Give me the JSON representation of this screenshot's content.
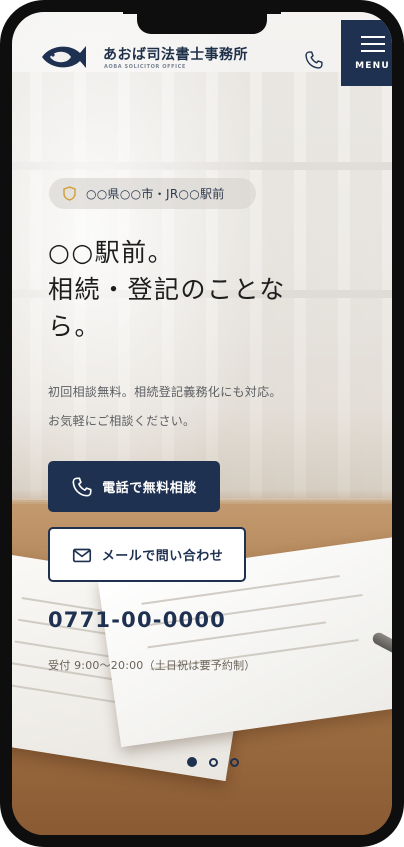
{
  "header": {
    "brand_name": "あおば司法書士事務所",
    "brand_subtitle": "AOBA SOLICITOR OFFICE",
    "menu_label": "MENU"
  },
  "hero": {
    "location_badge": "○○県○○市・JR○○駅前",
    "headline_line1": "○○駅前。",
    "headline_line2": "相続・登記のことな",
    "headline_line3": "ら。",
    "sub_line1": "初回相談無料。相続登記義務化にも対応。",
    "sub_line2": "お気軽にご相談ください。",
    "primary_button": "電話で無料相談",
    "secondary_button": "メールで問い合わせ",
    "phone_number": "0771-00-0000",
    "hours": "受付 9:00〜20:00（土日祝は要予約制）"
  },
  "slider": {
    "total": 3,
    "active_index": 0
  },
  "colors": {
    "navy": "#1f3150",
    "badge_icon": "#d4a23c"
  },
  "icons": [
    "fish-logo-icon",
    "phone-icon",
    "hamburger-menu-icon",
    "shield-icon",
    "mail-icon"
  ]
}
